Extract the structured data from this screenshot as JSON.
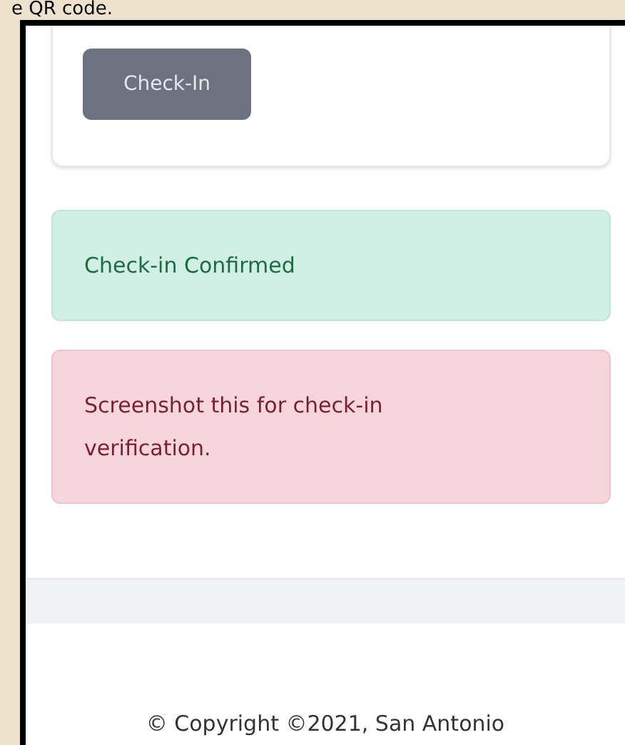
{
  "caption": "e QR code.",
  "check_in_button": {
    "label": "Check-In",
    "disabled": true
  },
  "alerts": [
    {
      "kind": "success",
      "text": "Check-in Confirmed"
    },
    {
      "kind": "danger",
      "text": "Screenshot this for check-in verification."
    }
  ],
  "footer": {
    "copyright": "© Copyright ©2021, San Antonio"
  }
}
